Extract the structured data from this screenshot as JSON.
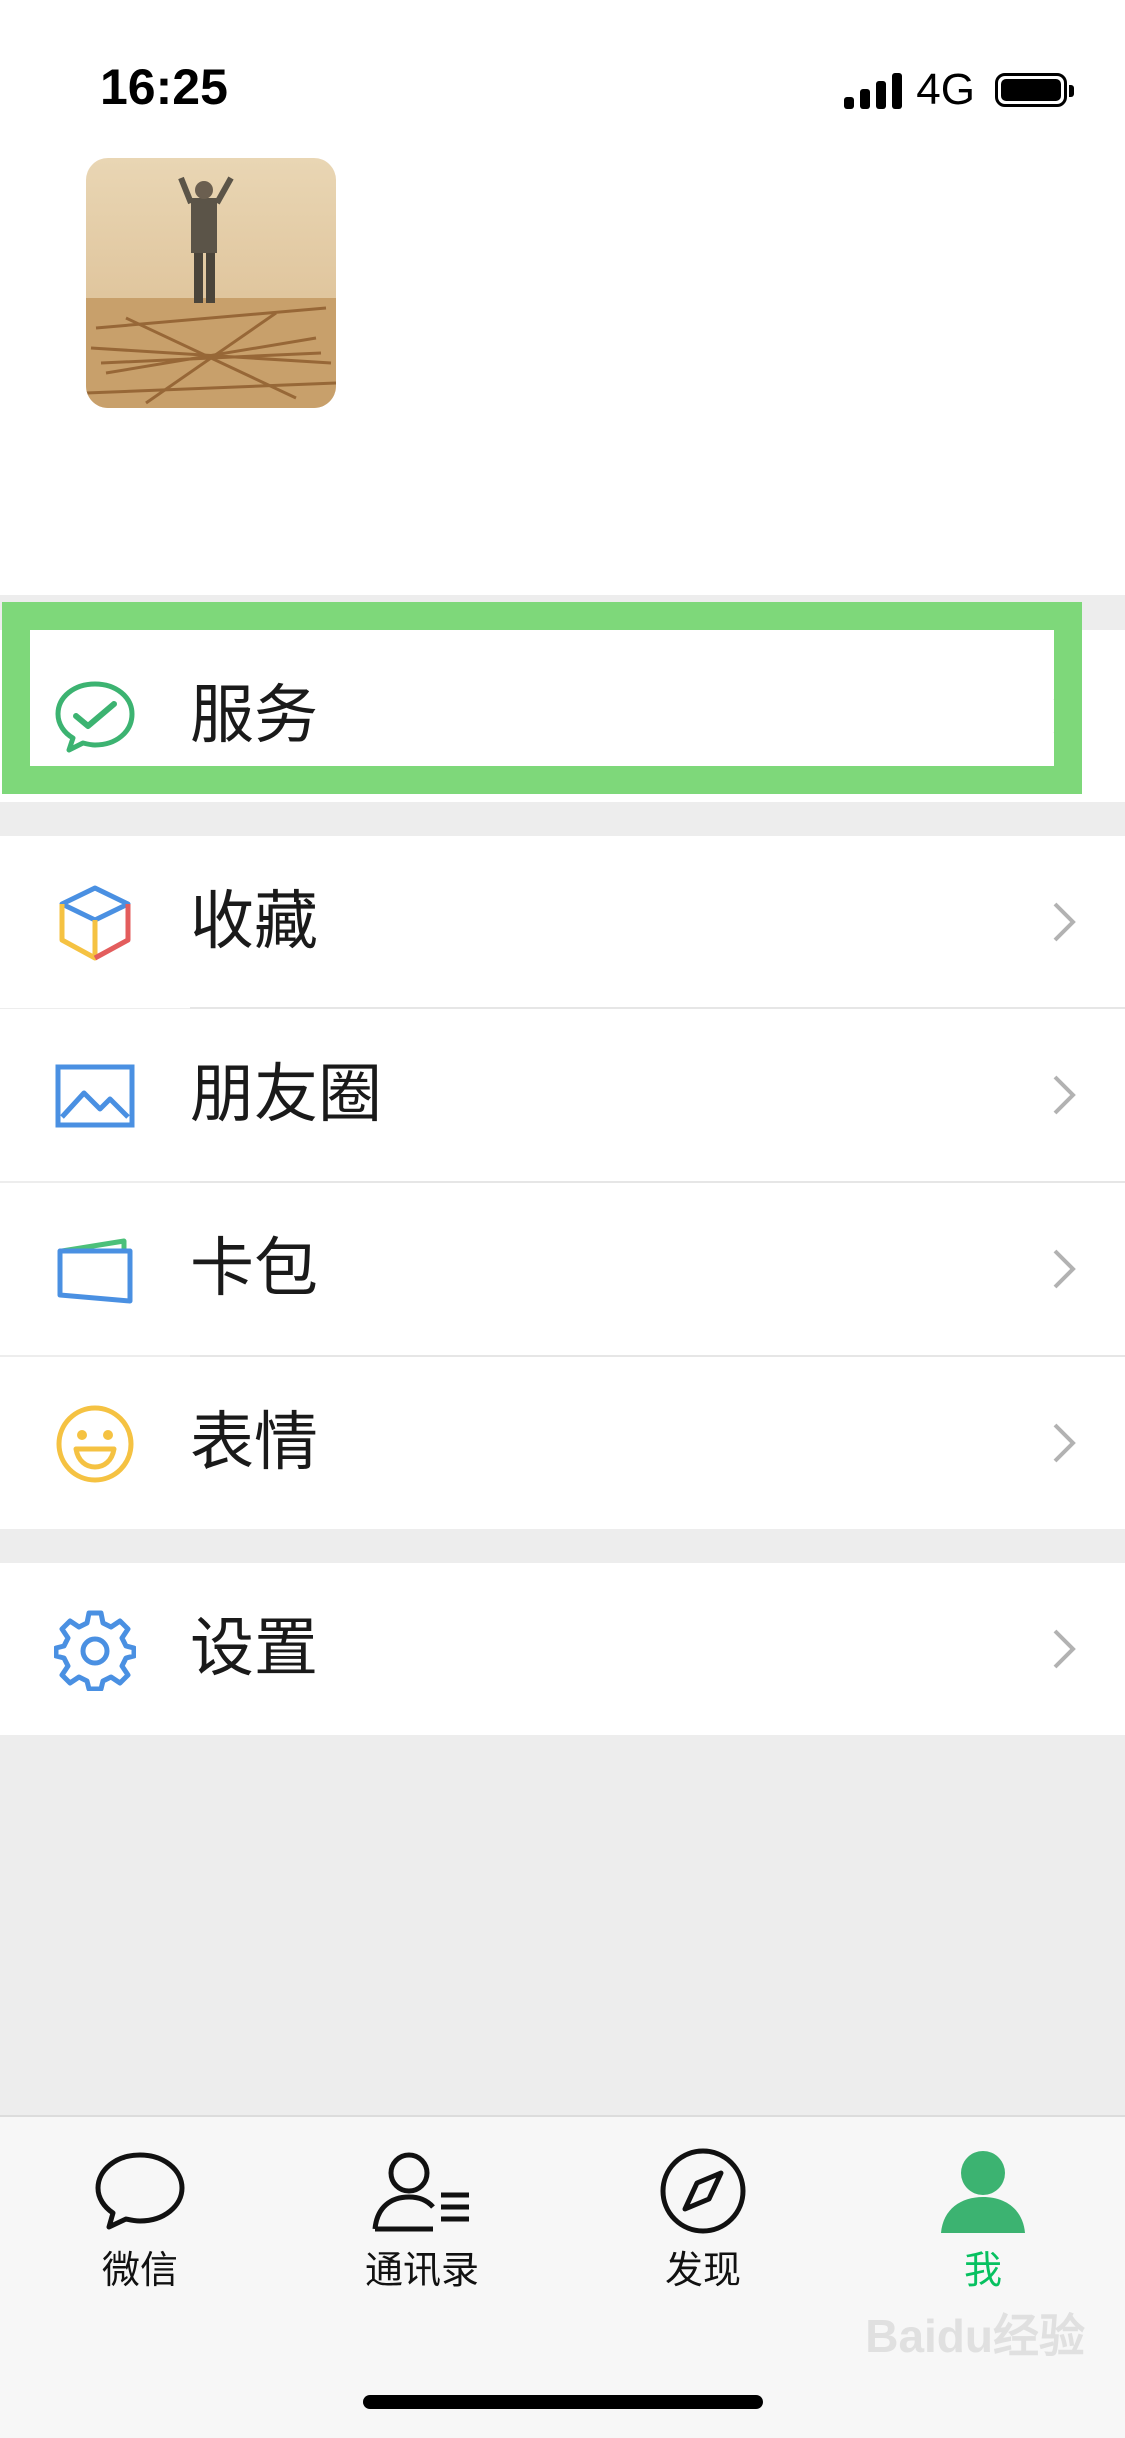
{
  "status_bar": {
    "time": "16:25",
    "network": "4G"
  },
  "menu": {
    "services": {
      "label": "服务",
      "icon": "wechat-pay-icon"
    },
    "favorites": {
      "label": "收藏",
      "icon": "cube-icon"
    },
    "moments": {
      "label": "朋友圈",
      "icon": "image-icon"
    },
    "cards": {
      "label": "卡包",
      "icon": "wallet-icon"
    },
    "stickers": {
      "label": "表情",
      "icon": "smiley-icon"
    },
    "settings": {
      "label": "设置",
      "icon": "gear-icon"
    }
  },
  "tabs": [
    {
      "label": "微信",
      "icon": "chat-bubble-icon",
      "active": false
    },
    {
      "label": "通讯录",
      "icon": "contacts-icon",
      "active": false
    },
    {
      "label": "发现",
      "icon": "compass-icon",
      "active": false
    },
    {
      "label": "我",
      "icon": "person-icon",
      "active": true
    }
  ],
  "colors": {
    "accent": "#07c160",
    "highlight": "#7ed87a",
    "background": "#ededed"
  },
  "watermark": "Baidu经验"
}
